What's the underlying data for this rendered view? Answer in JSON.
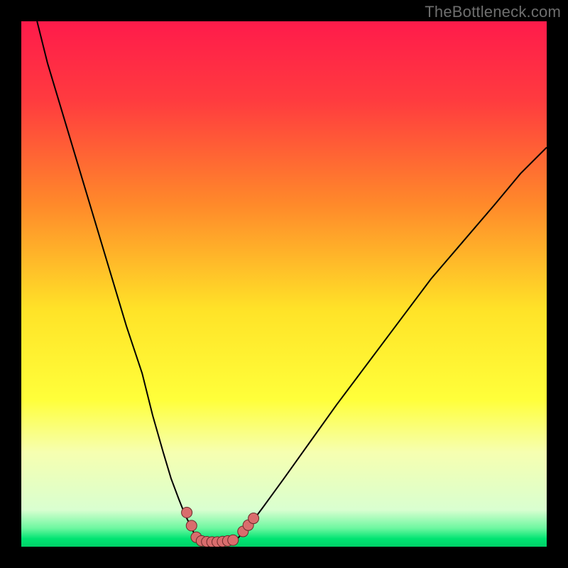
{
  "watermark": "TheBottleneck.com",
  "chart_data": {
    "type": "line",
    "title": "",
    "xlabel": "",
    "ylabel": "",
    "xlim": [
      0,
      100
    ],
    "ylim": [
      0,
      100
    ],
    "gradient_stops": [
      {
        "offset": 0.0,
        "color": "#ff1b4b"
      },
      {
        "offset": 0.15,
        "color": "#ff3b3f"
      },
      {
        "offset": 0.35,
        "color": "#ff8a2a"
      },
      {
        "offset": 0.55,
        "color": "#ffe328"
      },
      {
        "offset": 0.72,
        "color": "#ffff3a"
      },
      {
        "offset": 0.82,
        "color": "#f6ffb0"
      },
      {
        "offset": 0.93,
        "color": "#d9ffd0"
      },
      {
        "offset": 0.965,
        "color": "#6cf7a0"
      },
      {
        "offset": 0.985,
        "color": "#00e472"
      },
      {
        "offset": 1.0,
        "color": "#00d168"
      }
    ],
    "series": [
      {
        "name": "left-branch",
        "x": [
          3,
          5,
          8,
          11,
          14,
          17,
          20,
          23,
          25,
          27,
          28.5,
          30,
          31.2,
          32.2,
          33,
          33.8
        ],
        "y": [
          100,
          92,
          82,
          72,
          62,
          52,
          42,
          33,
          25,
          18,
          13,
          9,
          6,
          4,
          2.3,
          1.3
        ]
      },
      {
        "name": "bottom",
        "x": [
          33.8,
          34.6,
          35.4,
          36.2,
          37,
          37.8,
          38.6,
          39.4,
          40.2,
          41
        ],
        "y": [
          1.3,
          1.05,
          0.95,
          0.9,
          0.88,
          0.9,
          0.95,
          1.05,
          1.2,
          1.4
        ]
      },
      {
        "name": "right-branch",
        "x": [
          41,
          43,
          46,
          50,
          55,
          60,
          66,
          72,
          78,
          84,
          90,
          95,
          100
        ],
        "y": [
          1.4,
          3.5,
          7.5,
          13,
          20,
          27,
          35,
          43,
          51,
          58,
          65,
          71,
          76
        ]
      }
    ],
    "markers": [
      {
        "x": 31.5,
        "y": 6.5
      },
      {
        "x": 32.4,
        "y": 4.0
      },
      {
        "x": 33.3,
        "y": 1.8
      },
      {
        "x": 34.3,
        "y": 1.1
      },
      {
        "x": 35.3,
        "y": 0.95
      },
      {
        "x": 36.3,
        "y": 0.9
      },
      {
        "x": 37.3,
        "y": 0.9
      },
      {
        "x": 38.3,
        "y": 0.98
      },
      {
        "x": 39.3,
        "y": 1.1
      },
      {
        "x": 40.3,
        "y": 1.25
      },
      {
        "x": 42.2,
        "y": 2.9
      },
      {
        "x": 43.2,
        "y": 4.1
      },
      {
        "x": 44.2,
        "y": 5.4
      }
    ],
    "marker_style": {
      "r": 7.5,
      "fill": "#d96d6d",
      "stroke": "#6b2a2a"
    },
    "curve_style": {
      "stroke": "#000000",
      "width": 2
    }
  }
}
